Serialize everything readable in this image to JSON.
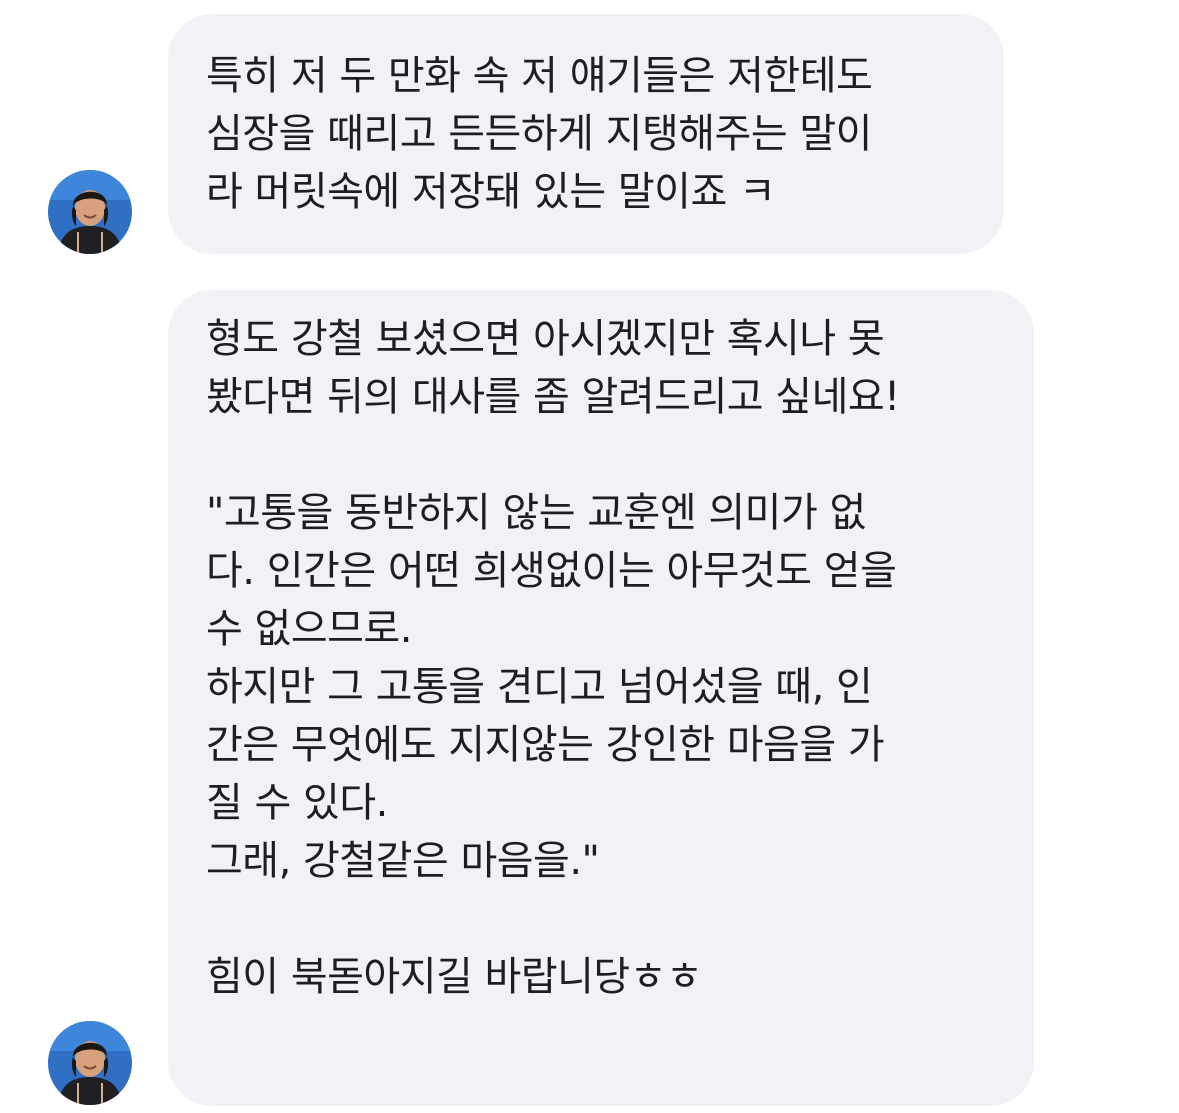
{
  "messages": [
    {
      "sender": "other",
      "lines": [
        "특히 저 두 만화 속 저 얘기들은 저한테도",
        "심장을 때리고 든든하게 지탱해주는 말이",
        "라 머릿속에 저장돼 있는 말이죠 ㅋ"
      ]
    },
    {
      "sender": "other",
      "lines": [
        "형도 강철 보셨으면 아시겠지만 혹시나 못",
        "봤다면 뒤의 대사를 좀 알려드리고 싶네요!",
        "",
        "\"고통을 동반하지 않는 교훈엔 의미가 없",
        "다. 인간은 어떤 희생없이는 아무것도 얻을",
        "수 없으므로.",
        "하지만 그 고통을 견디고 넘어섰을 때, 인",
        "간은 무엇에도 지지않는 강인한 마음을 가",
        "질 수 있다.",
        "그래, 강철같은 마음을.\"",
        "",
        "힘이 북돋아지길 바랍니당ㅎㅎ"
      ]
    }
  ],
  "colors": {
    "bubble_background": "#f1f2f6",
    "text": "#1c1e21",
    "avatar_background": "#2f6fc4"
  },
  "icons": {
    "avatar": "user-profile-photo"
  }
}
